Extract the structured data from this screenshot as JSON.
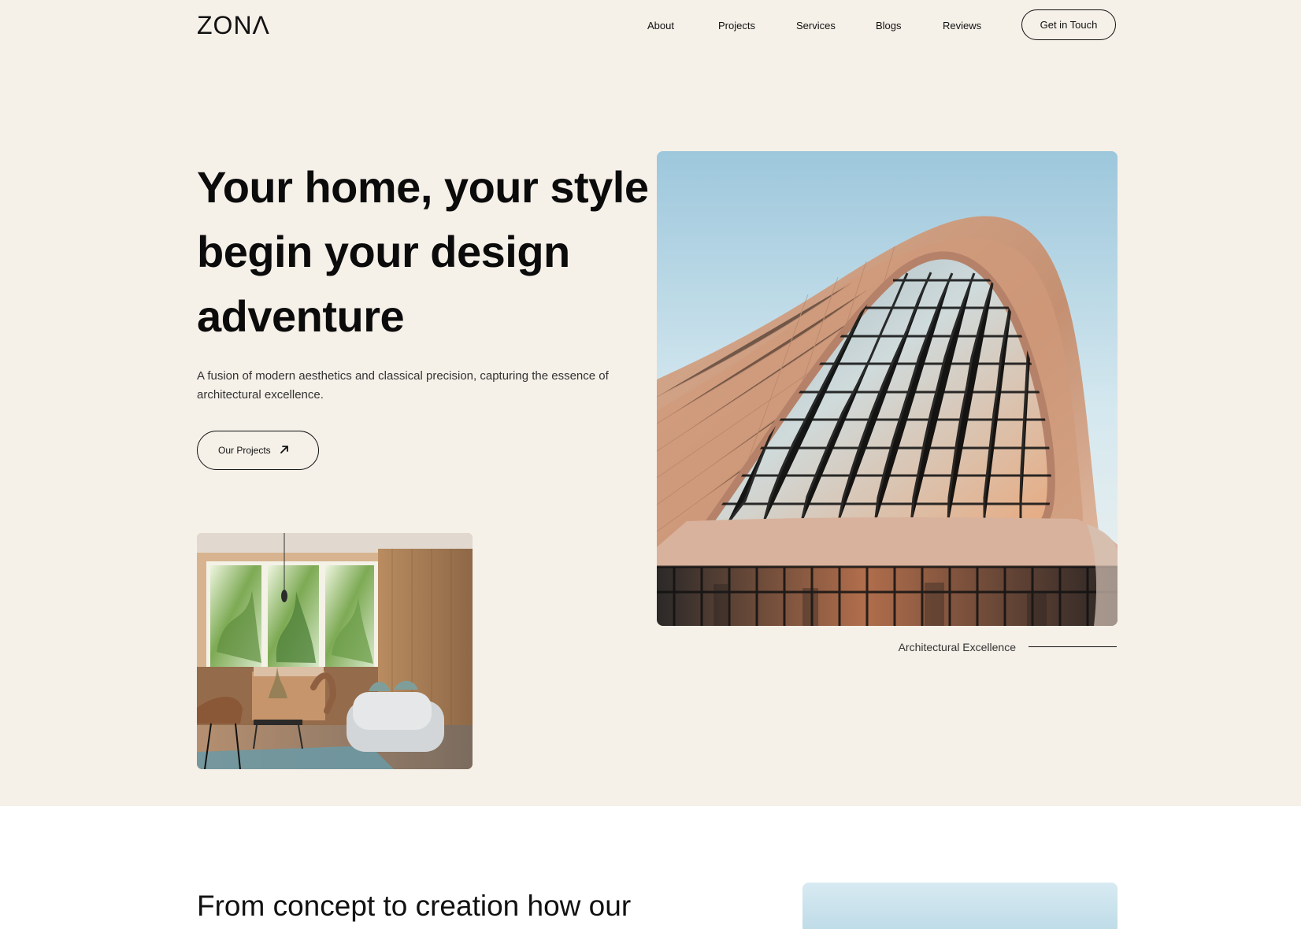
{
  "brand": {
    "logo": "ZONΛ"
  },
  "nav": {
    "items": [
      "About",
      "Projects",
      "Services",
      "Blogs",
      "Reviews"
    ],
    "cta": "Get in Touch"
  },
  "hero": {
    "title_lines": [
      "Your home, your style",
      "begin your design",
      "adventure"
    ],
    "subtitle": "A fusion of modern aesthetics and classical precision, capturing the essence of architectural excellence.",
    "button": {
      "label": "Our Projects",
      "icon": "arrow-up-right-icon"
    },
    "caption": "Architectural Excellence"
  },
  "section": {
    "title_visible": "From concept to creation how our"
  },
  "colors": {
    "hero_background": "#f5f0e8",
    "page_background": "#ffffff",
    "text": "#111111",
    "sky": "#9dc7dc",
    "facade": "#d4a88d"
  }
}
